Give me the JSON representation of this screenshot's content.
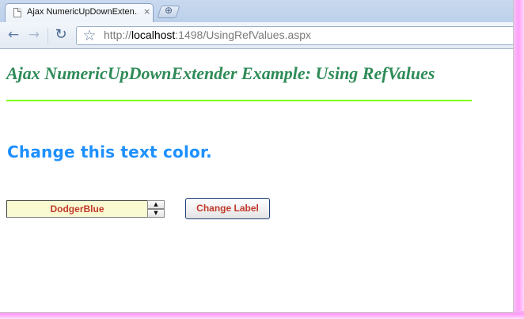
{
  "browser": {
    "tab_title": "Ajax NumericUpDownExten...",
    "tab_close_icon": "×",
    "new_tab_icon": "⊕",
    "url_scheme": "http://",
    "url_host": "localhost",
    "url_rest": ":1498/UsingRefValues.aspx"
  },
  "page": {
    "heading": "Ajax NumericUpDownExtender Example: Using RefValues",
    "target_label": "Change this text color.",
    "numeric_updown": {
      "value": "DodgerBlue",
      "up_icon": "▲",
      "down_icon": "▼"
    },
    "action_button_label": "Change Label"
  },
  "colors": {
    "heading": "#2e8b57",
    "rule": "#7cfc00",
    "target_label": "#1e90ff",
    "input_background": "#fafad2",
    "input_text": "#c0392b",
    "button_text": "#c0392b"
  },
  "icons": {
    "back": "back-arrow-icon",
    "forward": "forward-arrow-icon",
    "reload": "reload-icon",
    "bookmark": "star-icon",
    "page": "page-favicon-icon"
  }
}
